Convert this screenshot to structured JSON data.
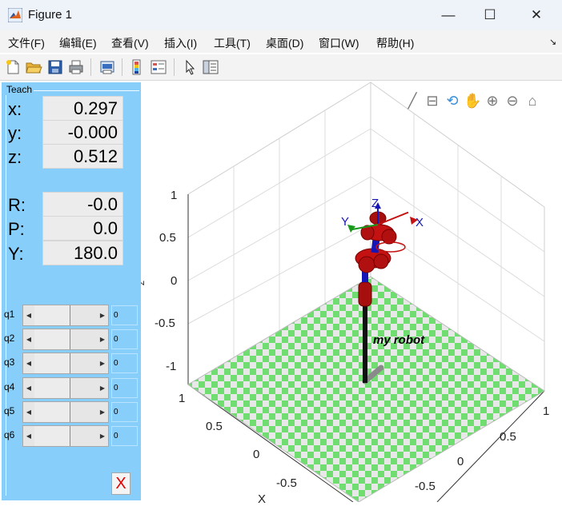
{
  "window": {
    "title": "Figure 1",
    "minimize": "—",
    "maximize": "☐",
    "close": "✕"
  },
  "menu": [
    "文件(F)",
    "编辑(E)",
    "查看(V)",
    "插入(I)",
    "工具(T)",
    "桌面(D)",
    "窗口(W)",
    "帮助(H)"
  ],
  "menu_corner": "↘",
  "toolbar": [
    "new-figure-icon",
    "open-file-icon",
    "save-icon",
    "print-icon",
    "print-preview-icon",
    "colorbar-icon",
    "legend-icon",
    "pointer-icon",
    "property-editor-icon"
  ],
  "axes_toolbar": [
    "brush-icon",
    "datatip-icon",
    "rotate-3d-icon",
    "pan-icon",
    "zoom-in-icon",
    "zoom-out-icon",
    "home-icon"
  ],
  "teach": {
    "title": "Teach",
    "position": [
      {
        "label": "x:",
        "value": "0.297"
      },
      {
        "label": "y:",
        "value": "-0.000"
      },
      {
        "label": "z:",
        "value": "0.512"
      }
    ],
    "orientation": [
      {
        "label": "R:",
        "value": "-0.0"
      },
      {
        "label": "P:",
        "value": "0.0"
      },
      {
        "label": "Y:",
        "value": "180.0"
      }
    ],
    "joints": [
      {
        "label": "q1",
        "value": "0"
      },
      {
        "label": "q2",
        "value": "0"
      },
      {
        "label": "q3",
        "value": "0"
      },
      {
        "label": "q4",
        "value": "0"
      },
      {
        "label": "q5",
        "value": "0"
      },
      {
        "label": "q6",
        "value": "0"
      }
    ],
    "close_label": "X"
  },
  "plot": {
    "z_ticks": [
      "1",
      "0.5",
      "0",
      "-0.5",
      "-1"
    ],
    "x_ticks": [
      "1",
      "0.5",
      "0",
      "-0.5"
    ],
    "y_ticks": [
      "1",
      "0.5",
      "0",
      "-0.5"
    ],
    "z_label": "Z",
    "x_label": "X",
    "robot_name": "my robot",
    "frame_axes": {
      "x": "X",
      "y": "Y",
      "z": "Z"
    },
    "floor_colors": [
      "#6fdd6f",
      "#e8e8e8"
    ],
    "link_color": "#c41212",
    "joint_axis_color": "#1515b8"
  }
}
